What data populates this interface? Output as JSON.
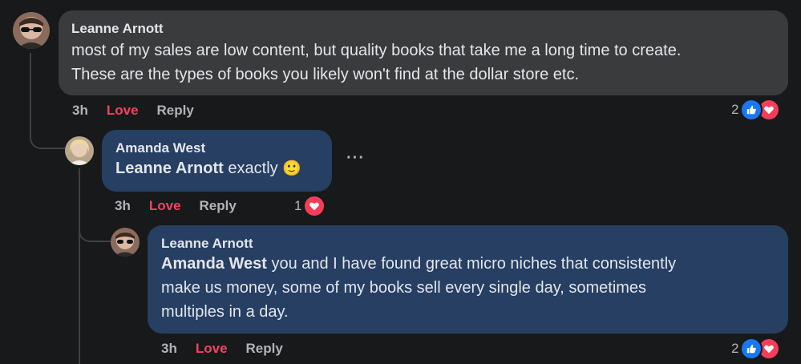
{
  "comments": [
    {
      "author": "Leanne Arnott",
      "text_line1": "most of my sales are low content, but quality books that take me a long time to create.",
      "text_line2": "These are the types of books you likely won't find at the dollar store etc.",
      "time": "3h",
      "love": "Love",
      "reply": "Reply",
      "reaction_count": "2"
    },
    {
      "author": "Amanda West",
      "mention": "Leanne Arnott",
      "text": " exactly ",
      "emoji": "🙂",
      "time": "3h",
      "love": "Love",
      "reply": "Reply",
      "reaction_count": "1",
      "more": "···"
    },
    {
      "author": "Leanne Arnott",
      "mention": "Amanda West",
      "text_line1": " you and I have found great micro niches that consistently",
      "text_line2": "make us money, some of my books sell every single day, sometimes",
      "text_line3": "multiples in a day.",
      "time": "3h",
      "love": "Love",
      "reply": "Reply",
      "reaction_count": "2"
    }
  ],
  "colors": {
    "background": "#18191a",
    "bubble_dark": "#3a3b3c",
    "bubble_highlight": "#263f63",
    "love": "#f3425f",
    "like": "#1877f2"
  },
  "icons": [
    "like-icon",
    "love-icon",
    "more-options-icon"
  ]
}
